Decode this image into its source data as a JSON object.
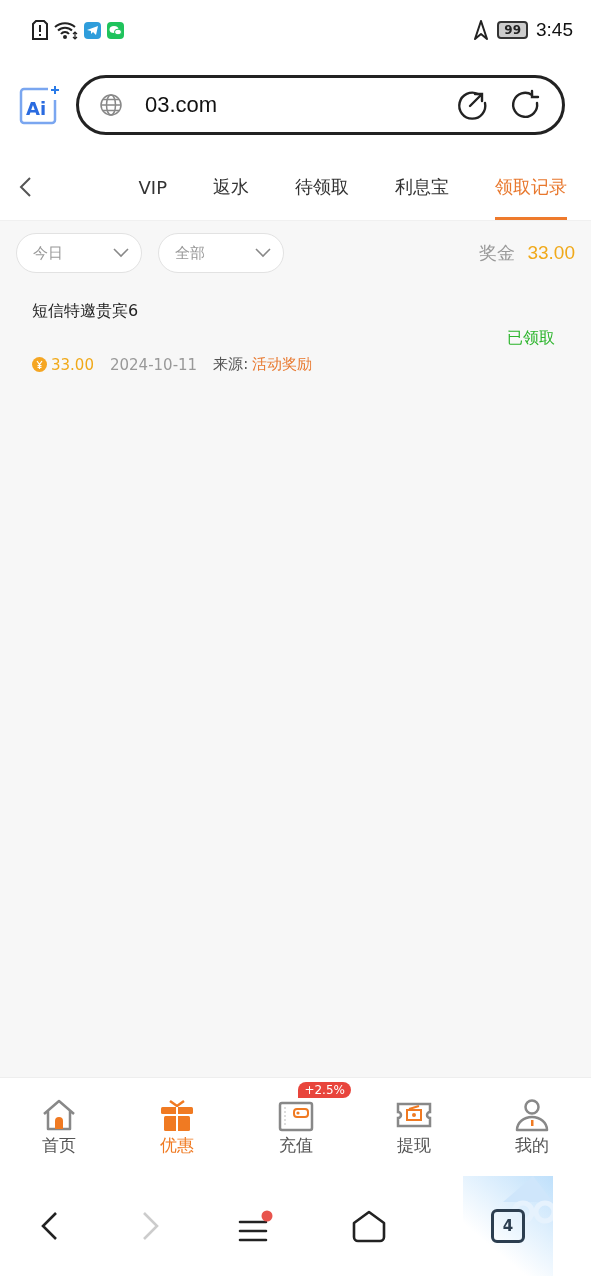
{
  "status_bar": {
    "time": "3:45",
    "battery": "99"
  },
  "logo": {
    "text": "Ai"
  },
  "address_bar": {
    "url": "03.com"
  },
  "tabs": [
    {
      "label": "VIP",
      "selected": false
    },
    {
      "label": "返水",
      "selected": false
    },
    {
      "label": "待领取",
      "selected": false
    },
    {
      "label": "利息宝",
      "selected": false
    },
    {
      "label": "领取记录",
      "selected": true
    }
  ],
  "filters": [
    {
      "value": "今日"
    },
    {
      "value": "全部"
    }
  ],
  "bonus": {
    "label": "奖金",
    "value": "33.00"
  },
  "records": [
    {
      "title": "短信特邀贵宾6",
      "status": "已领取",
      "amount": "33.00",
      "date": "2024-10-11",
      "source_label": "来源:",
      "source": "活动奖励"
    }
  ],
  "bottom_nav": [
    {
      "label": "首页",
      "selected": false
    },
    {
      "label": "优惠",
      "selected": true
    },
    {
      "label": "充值",
      "selected": false,
      "badge": "+2.5%"
    },
    {
      "label": "提现",
      "selected": false
    },
    {
      "label": "我的",
      "selected": false
    }
  ],
  "browser_nav": {
    "back_disabled": false,
    "forward_disabled": true,
    "menu_dot": true,
    "tab_count": "4"
  }
}
